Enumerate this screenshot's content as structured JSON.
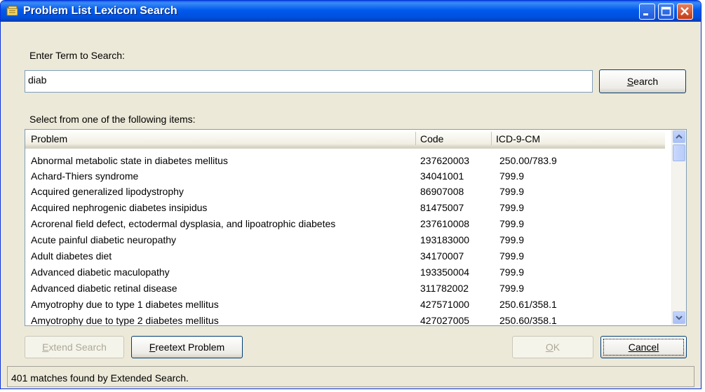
{
  "window": {
    "title": "Problem List  Lexicon Search"
  },
  "search": {
    "label": "Enter Term to Search:",
    "value": "diab",
    "button_prefix": "",
    "button_accel": "S",
    "button_rest": "earch"
  },
  "list": {
    "label": "Select from one of the following items:",
    "columns": [
      "Problem",
      "Code",
      "ICD-9-CM"
    ],
    "rows": [
      [
        "Abnormal metabolic state in diabetes mellitus",
        "237620003",
        "250.00/783.9"
      ],
      [
        "Achard-Thiers syndrome",
        "34041001",
        "799.9"
      ],
      [
        "Acquired generalized lipodystrophy",
        "86907008",
        "799.9"
      ],
      [
        "Acquired nephrogenic diabetes insipidus",
        "81475007",
        "799.9"
      ],
      [
        "Acrorenal field defect, ectodermal dysplasia, and lipoatrophic diabetes",
        "237610008",
        "799.9"
      ],
      [
        "Acute painful diabetic neuropathy",
        "193183000",
        "799.9"
      ],
      [
        "Adult diabetes diet",
        "34170007",
        "799.9"
      ],
      [
        "Advanced diabetic maculopathy",
        "193350004",
        "799.9"
      ],
      [
        "Advanced diabetic retinal disease",
        "311782002",
        "799.9"
      ],
      [
        "Amyotrophy due to type 1 diabetes mellitus",
        "427571000",
        "250.61/358.1"
      ],
      [
        "Amyotrophy due to type 2 diabetes mellitus",
        "427027005",
        "250.60/358.1"
      ]
    ]
  },
  "buttons": {
    "extend": {
      "prefix": "",
      "accel": "E",
      "rest": "xtend Search"
    },
    "freetext": {
      "prefix": "",
      "accel": "F",
      "rest": "reetext Problem"
    },
    "ok": {
      "prefix": "",
      "accel": "O",
      "rest": "K"
    },
    "cancel": {
      "prefix": "",
      "accel": "",
      "rest": "Cancel"
    }
  },
  "status": {
    "text": "401 matches found by Extended Search."
  },
  "colors": {
    "titlebar": "#0058EE",
    "face": "#ECE9D8",
    "border": "#7F9DB9",
    "close": "#C43B15"
  }
}
